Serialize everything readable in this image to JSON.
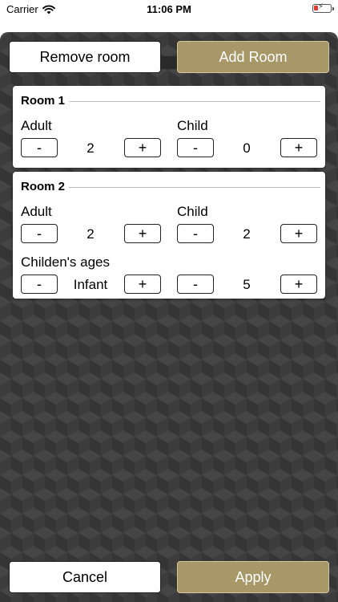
{
  "status_bar": {
    "carrier": "Carrier",
    "time": "11:06 PM"
  },
  "top_actions": {
    "remove_label": "Remove room",
    "add_label": "Add Room"
  },
  "rooms": [
    {
      "title": "Room 1",
      "adult_label": "Adult",
      "adult_value": "2",
      "child_label": "Child",
      "child_value": "0",
      "minus": "-",
      "plus": "+"
    },
    {
      "title": "Room 2",
      "adult_label": "Adult",
      "adult_value": "2",
      "child_label": "Child",
      "child_value": "2",
      "ages_label": "Childen's ages",
      "age_1_value": "Infant",
      "age_2_value": "5",
      "minus": "-",
      "plus": "+"
    }
  ],
  "bottom_actions": {
    "cancel_label": "Cancel",
    "apply_label": "Apply"
  },
  "colors": {
    "accent_gold": "#a89868",
    "background_dark": "#3c3c3c"
  }
}
